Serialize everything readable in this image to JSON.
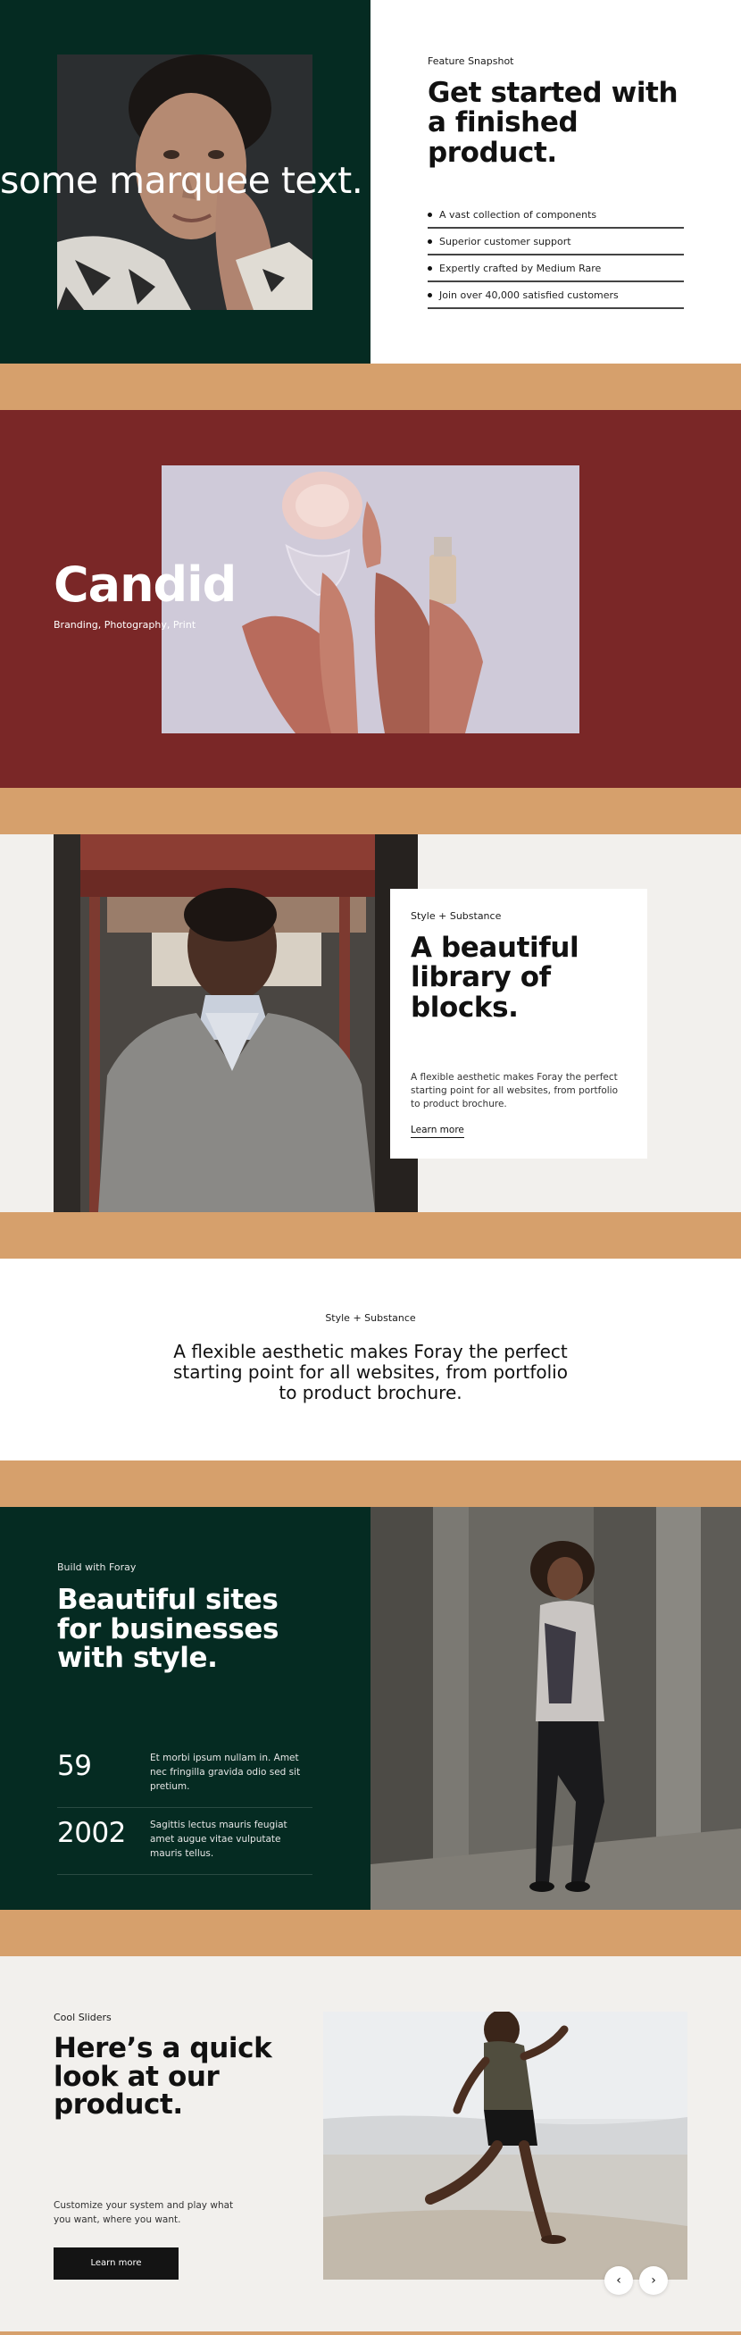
{
  "feature_snapshot": {
    "marquee_text": "some marquee text.",
    "eyebrow": "Feature Snapshot",
    "headline": "Get started with a finished product.",
    "list": [
      "A vast collection of components",
      "Superior customer support",
      "Expertly crafted by Medium Rare",
      "Join over 40,000 satisfied customers"
    ]
  },
  "project": {
    "title": "Candid",
    "subtitle": "Branding, Photography, Print"
  },
  "blocks": {
    "eyebrow": "Style + Substance",
    "headline": "A beautiful library of blocks.",
    "body": "A flexible aesthetic makes Foray the perfect starting point for all websites, from portfolio to product brochure.",
    "link": "Learn more"
  },
  "statement": {
    "eyebrow": "Style + Substance",
    "text": "A flexible aesthetic makes Foray the perfect starting point for all websites, from portfolio to product brochure."
  },
  "build": {
    "eyebrow": "Build with Foray",
    "headline": "Beautiful sites for businesses with style.",
    "stats": [
      {
        "number": "59",
        "text": "Et morbi ipsum nullam in. Amet nec fringilla gravida odio sed sit pretium."
      },
      {
        "number": "2002",
        "text": "Sagittis lectus mauris feugiat amet augue vitae vulputate mauris tellus."
      }
    ]
  },
  "sliders": {
    "eyebrow": "Cool Sliders",
    "headline": "Here’s a quick look at our product.",
    "body": "Customize your system and play what you want, where you want.",
    "button": "Learn more",
    "prev_icon": "chevron-left-icon",
    "next_icon": "chevron-right-icon"
  },
  "colors": {
    "forest": "#052b22",
    "tan": "#d6a06c",
    "maroon": "#7a2727",
    "offwhite": "#f2f0ed"
  }
}
